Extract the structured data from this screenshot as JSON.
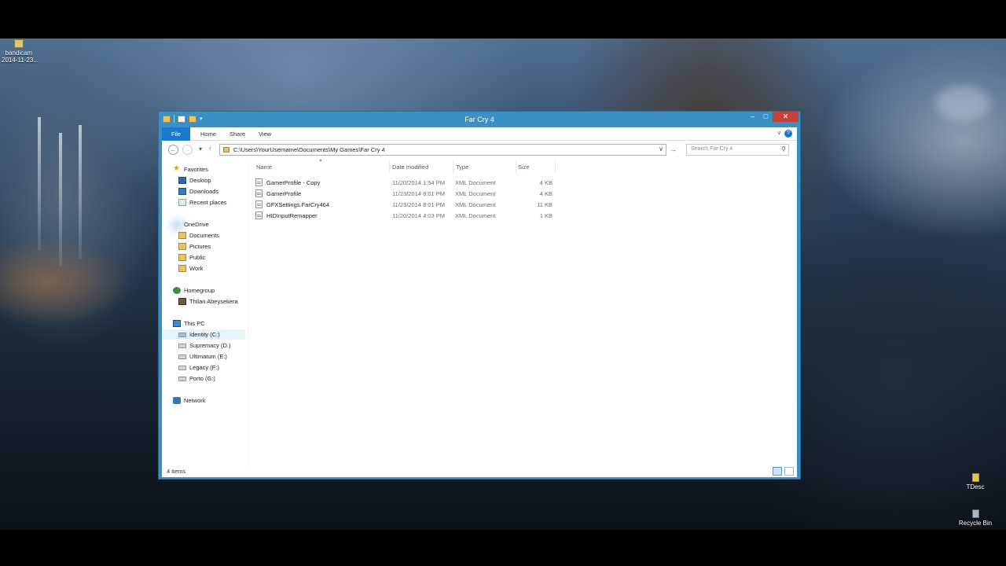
{
  "desktop": {
    "icons": [
      {
        "label": "bandicam\n2014-11-23..."
      },
      {
        "label": "TDesc"
      },
      {
        "label": "Recycle Bin"
      }
    ]
  },
  "window": {
    "title": "Far Cry 4",
    "ribbon_tabs": [
      "File",
      "Home",
      "Share",
      "View"
    ],
    "address": "C:\\Users\\YourUsername\\Documents\\My Games\\Far Cry 4",
    "search_placeholder": "Search Far Cry 4",
    "nav": {
      "favorites": {
        "label": "Favorites",
        "items": [
          "Desktop",
          "Downloads",
          "Recent places"
        ]
      },
      "onedrive": {
        "label": "OneDrive",
        "items": [
          "Documents",
          "Pictures",
          "Public",
          "Work"
        ]
      },
      "homegroup": {
        "label": "Homegroup",
        "items": [
          "Thilan Abeysekera"
        ]
      },
      "thispc": {
        "label": "This PC",
        "items": [
          "Identity (C:)",
          "Supremacy (D:)",
          "Ultimatum (E:)",
          "Legacy (F:)",
          "Porto (G:)"
        ]
      },
      "network": {
        "label": "Network"
      }
    },
    "columns": {
      "name": "Name",
      "date": "Date modified",
      "type": "Type",
      "size": "Size"
    },
    "files": [
      {
        "name": "GamerProfile - Copy",
        "date": "11/20/2014 1:54 PM",
        "type": "XML Document",
        "size": "4 KB"
      },
      {
        "name": "GamerProfile",
        "date": "11/23/2014 8:01 PM",
        "type": "XML Document",
        "size": "4 KB"
      },
      {
        "name": "GFXSettings.FarCry464",
        "date": "11/23/2014 8:01 PM",
        "type": "XML Document",
        "size": "11 KB"
      },
      {
        "name": "HIDInputRemapper",
        "date": "11/20/2014 4:03 PM",
        "type": "XML Document",
        "size": "1 KB"
      }
    ],
    "status": "4 items"
  }
}
